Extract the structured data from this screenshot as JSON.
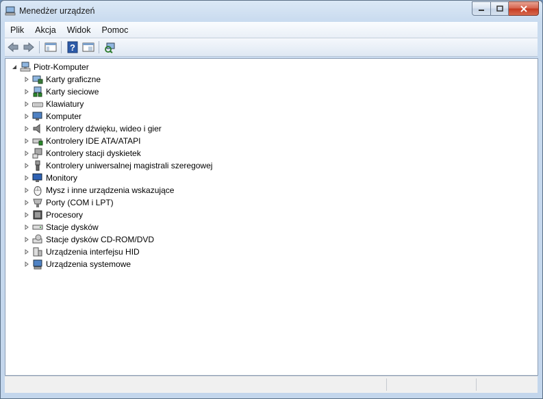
{
  "window": {
    "title": "Menedżer urządzeń"
  },
  "menu": [
    {
      "label": "Plik"
    },
    {
      "label": "Akcja"
    },
    {
      "label": "Widok"
    },
    {
      "label": "Pomoc"
    }
  ],
  "toolbar": {
    "buttons": [
      "back-icon",
      "forward-icon",
      "show-hide-console-tree-icon",
      "help-icon",
      "properties-icon",
      "scan-hardware-changes-icon"
    ]
  },
  "tree": {
    "root": {
      "label": "Piotr-Komputer",
      "icon": "computer-icon"
    },
    "categories": [
      {
        "label": "Karty graficzne",
        "icon": "display-adapter-icon"
      },
      {
        "label": "Karty sieciowe",
        "icon": "network-adapter-icon"
      },
      {
        "label": "Klawiatury",
        "icon": "keyboard-icon"
      },
      {
        "label": "Komputer",
        "icon": "computer-monitor-icon"
      },
      {
        "label": "Kontrolery dźwięku, wideo i gier",
        "icon": "speaker-icon"
      },
      {
        "label": "Kontrolery IDE ATA/ATAPI",
        "icon": "ide-controller-icon"
      },
      {
        "label": "Kontrolery stacji dyskietek",
        "icon": "floppy-controller-icon"
      },
      {
        "label": "Kontrolery uniwersalnej magistrali szeregowej",
        "icon": "usb-icon"
      },
      {
        "label": "Monitory",
        "icon": "monitor-icon"
      },
      {
        "label": "Mysz i inne urządzenia wskazujące",
        "icon": "mouse-icon"
      },
      {
        "label": "Porty (COM i LPT)",
        "icon": "port-icon"
      },
      {
        "label": "Procesory",
        "icon": "processor-icon"
      },
      {
        "label": "Stacje dysków",
        "icon": "disk-drive-icon"
      },
      {
        "label": "Stacje dysków CD-ROM/DVD",
        "icon": "cdrom-icon"
      },
      {
        "label": "Urządzenia interfejsu HID",
        "icon": "hid-icon"
      },
      {
        "label": "Urządzenia systemowe",
        "icon": "system-devices-icon"
      }
    ]
  },
  "colors": {
    "accent": "#c3d6ec",
    "close": "#c4391f"
  }
}
